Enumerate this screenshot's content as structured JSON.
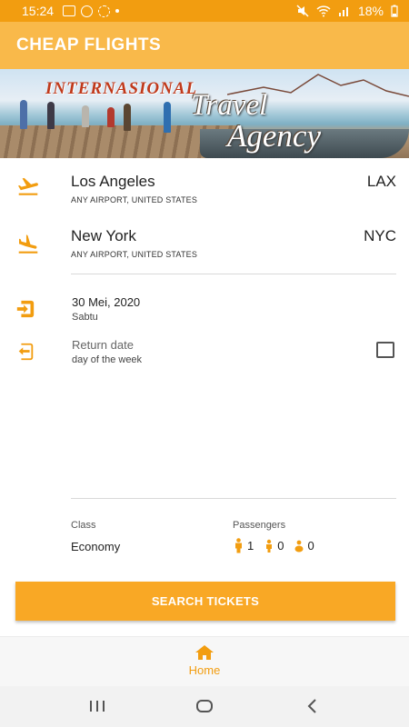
{
  "status_bar": {
    "time": "15:24",
    "battery": "18%"
  },
  "app_bar": {
    "title": "CHEAP FLIGHTS"
  },
  "banner": {
    "brand": "INTERNASIONAL",
    "title_line1": "Travel",
    "title_line2": "Agency"
  },
  "route": {
    "from": {
      "city": "Los Angeles",
      "airport": "ANY AIRPORT, UNITED STATES",
      "code": "LAX"
    },
    "to": {
      "city": "New York",
      "airport": "ANY AIRPORT, UNITED STATES",
      "code": "NYC"
    }
  },
  "dates": {
    "departure": {
      "date": "30 Mei, 2020",
      "weekday": "Sabtu"
    },
    "return": {
      "label": "Return date",
      "sub": "day of the week",
      "checked": false
    }
  },
  "booking": {
    "class_label": "Class",
    "class_value": "Economy",
    "passengers_label": "Passengers",
    "adults": "1",
    "children": "0",
    "infants": "0"
  },
  "actions": {
    "search": "SEARCH TICKETS"
  },
  "bottom_nav": {
    "home": "Home"
  },
  "colors": {
    "accent": "#f29d10",
    "app_bar": "#f9b94a",
    "button": "#f9a825"
  },
  "icons": {
    "departure": "flight-takeoff-icon",
    "arrival": "flight-land-icon",
    "depart_date": "login-arrow-icon",
    "return_date": "logout-arrow-icon",
    "passenger": "person-icon",
    "home": "home-icon"
  }
}
